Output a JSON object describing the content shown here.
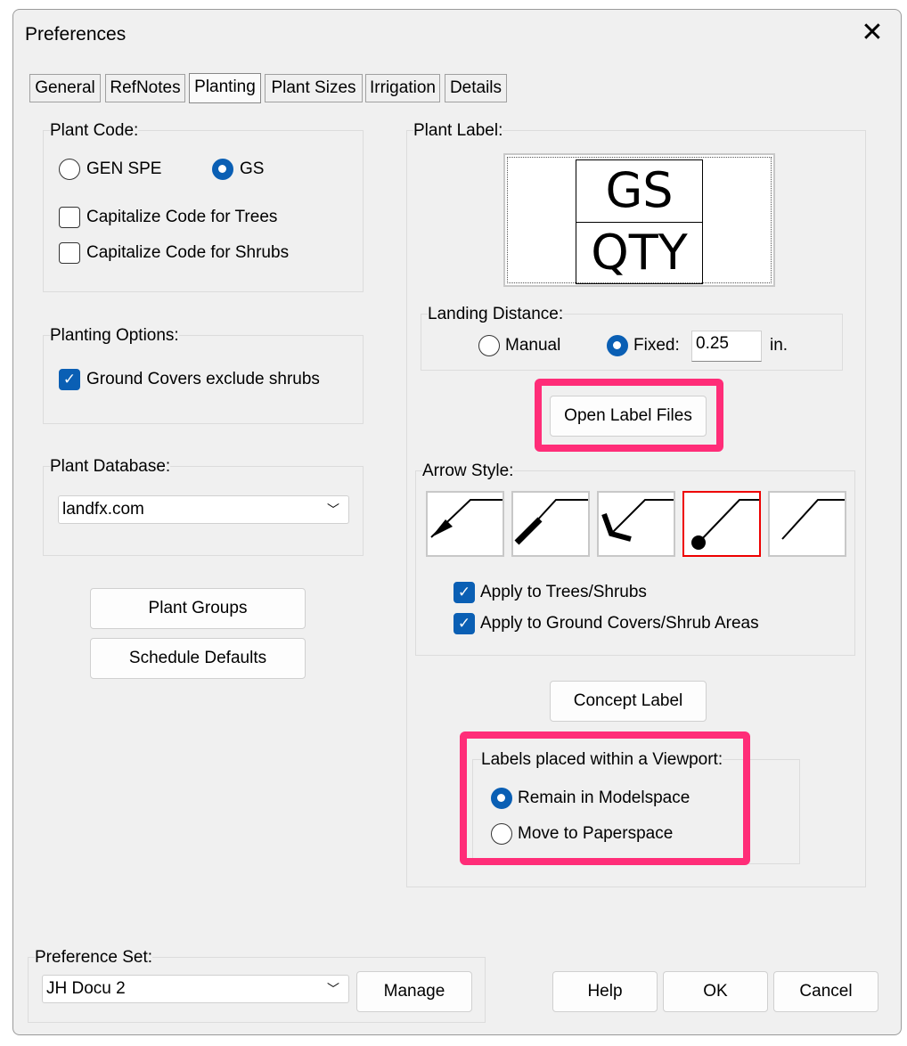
{
  "window": {
    "title": "Preferences",
    "close_icon": "close-icon"
  },
  "tabs": [
    {
      "label": "General"
    },
    {
      "label": "RefNotes"
    },
    {
      "label": "Planting",
      "active": true
    },
    {
      "label": "Plant Sizes"
    },
    {
      "label": "Irrigation"
    },
    {
      "label": "Details"
    }
  ],
  "plant_code": {
    "title": "Plant Code:",
    "options": [
      {
        "label": "GEN SPE",
        "selected": false
      },
      {
        "label": "GS",
        "selected": true
      }
    ],
    "checks": [
      {
        "label": "Capitalize Code for Trees",
        "checked": false
      },
      {
        "label": "Capitalize Code for Shrubs",
        "checked": false
      }
    ]
  },
  "planting_options": {
    "title": "Planting Options:",
    "checks": [
      {
        "label": "Ground Covers exclude shrubs",
        "checked": true
      }
    ]
  },
  "plant_database": {
    "title": "Plant Database:",
    "value": "landfx.com"
  },
  "buttons": {
    "plant_groups": "Plant Groups",
    "schedule_defaults": "Schedule Defaults",
    "open_label_files": "Open Label Files",
    "concept_label": "Concept Label",
    "manage": "Manage",
    "help": "Help",
    "ok": "OK",
    "cancel": "Cancel"
  },
  "plant_label": {
    "title": "Plant Label:",
    "preview_top": "GS",
    "preview_bottom": "QTY"
  },
  "landing_distance": {
    "title": "Landing Distance:",
    "manual": "Manual",
    "fixed": "Fixed:",
    "selected": "Fixed",
    "value": "0.25",
    "unit": "in."
  },
  "arrow_style": {
    "title": "Arrow Style:",
    "styles": [
      "arrow-filled",
      "arrow-bar",
      "arrow-open",
      "dot",
      "none"
    ],
    "selected_index": 3,
    "checks": [
      {
        "label": "Apply to Trees/Shrubs",
        "checked": true
      },
      {
        "label": "Apply to Ground Covers/Shrub Areas",
        "checked": true
      }
    ]
  },
  "viewport": {
    "title": "Labels placed within a Viewport:",
    "options": [
      {
        "label": "Remain in Modelspace",
        "selected": true
      },
      {
        "label": "Move to Paperspace",
        "selected": false
      }
    ]
  },
  "preference_set": {
    "title": "Preference Set:",
    "value": "JH Docu 2"
  },
  "colors": {
    "highlight": "#ff2d78",
    "accent": "#0a5fb4",
    "selected_arrow": "#e00000"
  }
}
